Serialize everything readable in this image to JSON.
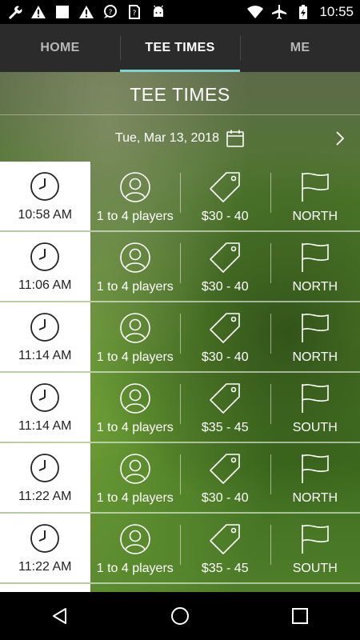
{
  "tabs": [
    {
      "label": "HOME",
      "active": false
    },
    {
      "label": "TEE TIMES",
      "active": true
    },
    {
      "label": "ME",
      "active": false
    }
  ],
  "status": {
    "time": "10:55"
  },
  "header": {
    "title": "TEE TIMES"
  },
  "date_selector": {
    "date": "Tue, Mar 13, 2018"
  },
  "tee_times": [
    {
      "time": "10:58 AM",
      "players": "1 to 4 players",
      "price": "$30 - 40",
      "course": "NORTH"
    },
    {
      "time": "11:06 AM",
      "players": "1 to 4 players",
      "price": "$30 - 40",
      "course": "NORTH"
    },
    {
      "time": "11:14 AM",
      "players": "1 to 4 players",
      "price": "$30 - 40",
      "course": "NORTH"
    },
    {
      "time": "11:14 AM",
      "players": "1 to 4 players",
      "price": "$35 - 45",
      "course": "SOUTH"
    },
    {
      "time": "11:22 AM",
      "players": "1 to 4 players",
      "price": "$30 - 40",
      "course": "NORTH"
    },
    {
      "time": "11:22 AM",
      "players": "1 to 4 players",
      "price": "$35 - 45",
      "course": "SOUTH"
    }
  ],
  "colors": {
    "tab_indicator": "#7fd3d0",
    "tabbar_bg": "#2b2b2b"
  }
}
